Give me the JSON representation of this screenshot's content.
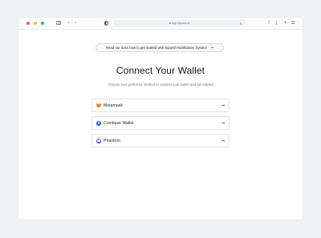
{
  "browser": {
    "url": "App.Squash.io",
    "icons": {
      "back": "chevron-left-icon",
      "forward": "chevron-right-icon",
      "sidebar": "sidebar-icon",
      "shield": "shield-icon",
      "reload": "reload-icon",
      "share": "share-icon",
      "download": "download-icon",
      "new_tab": "plus-icon",
      "tabs": "tabs-icon"
    }
  },
  "page": {
    "docs_banner": "Read our docs how to get started with Squash Notification System",
    "title": "Connect Your Wallet",
    "subtitle": "Choose your preferred method to connect your wallet and get started"
  },
  "wallets": [
    {
      "label": "Metamask",
      "icon": "metamask-icon"
    },
    {
      "label": "Coinbase Wallet",
      "icon": "coinbase-icon"
    },
    {
      "label": "Phantom",
      "icon": "phantom-icon"
    }
  ],
  "colors": {
    "traffic_red": "#f25f57",
    "traffic_yellow": "#f6be2f",
    "traffic_green": "#2ac840",
    "metamask": "#e8831d",
    "coinbase": "#1652f0",
    "phantom": "#4b3ee0"
  }
}
